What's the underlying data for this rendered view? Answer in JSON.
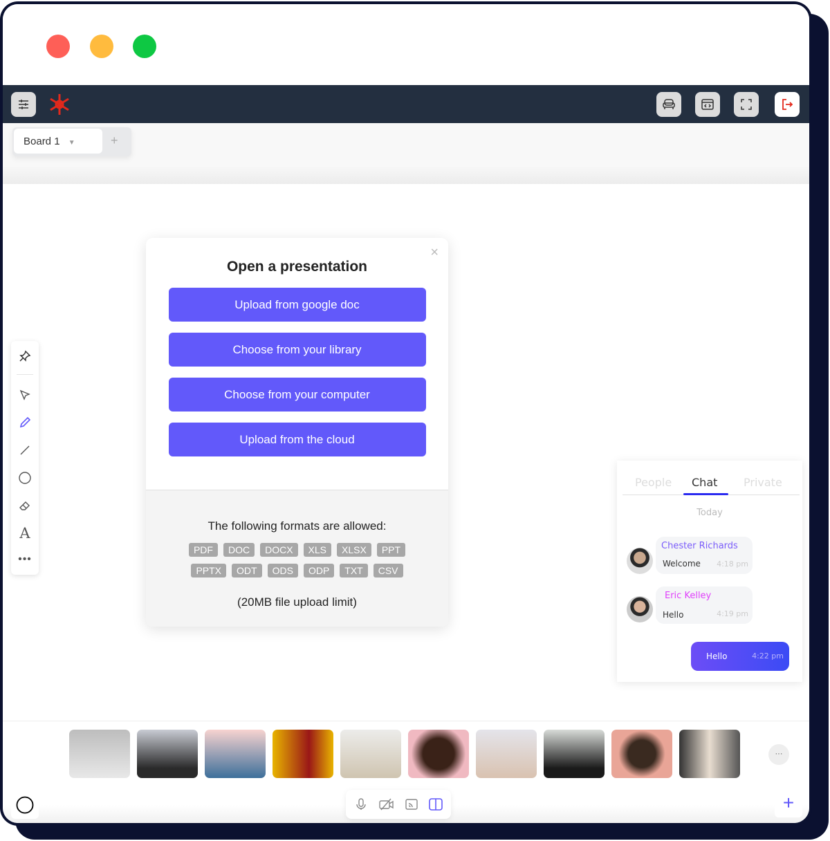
{
  "window": {
    "controls": [
      {
        "name": "close",
        "color": "#fe5f57"
      },
      {
        "name": "minimize",
        "color": "#ffbb3e"
      },
      {
        "name": "maximize",
        "color": "#0ec843"
      }
    ]
  },
  "topbar": {
    "icons": [
      "settings-sliders-icon",
      "logo-icon",
      "sofa-icon",
      "embed-code-icon",
      "fullscreen-icon",
      "exit-icon"
    ],
    "brand_color": "#e3291c"
  },
  "board": {
    "tab_label": "Board 1",
    "add_label": "+"
  },
  "modal": {
    "title": "Open a presentation",
    "close": "×",
    "buttons": [
      "Upload from google doc",
      "Choose from your library",
      "Choose from your computer",
      "Upload from the cloud"
    ],
    "formats_label": "The following formats are allowed:",
    "formats_row1": [
      "PDF",
      "DOC",
      "DOCX",
      "XLS",
      "XLSX",
      "PPT"
    ],
    "formats_row2": [
      "PPTX",
      "ODT",
      "ODS",
      "ODP",
      "TXT",
      "CSV"
    ],
    "limit": "(20MB file upload limit)",
    "accent": "#6259fa"
  },
  "tools": [
    "pin-icon",
    "pointer-icon",
    "pencil-icon",
    "line-icon",
    "circle-icon",
    "eraser-icon",
    "text-icon",
    "more-icon"
  ],
  "chat": {
    "tabs": [
      "People",
      "Chat",
      "Private"
    ],
    "active_tab": "Chat",
    "date": "Today",
    "messages": [
      {
        "name": "Chester Richards",
        "text": "Welcome",
        "time": "4:18 pm",
        "name_color": "#7a5cfa"
      },
      {
        "name": "Eric Kelley",
        "text": "Hello",
        "time": "4:19 pm",
        "name_color": "#e040fb"
      }
    ],
    "own": {
      "text": "Hello",
      "time": "4:22 pm"
    }
  },
  "participants": {
    "count": 10,
    "more": "···"
  },
  "bottom": {
    "icons": [
      "microphone-icon",
      "camera-off-icon",
      "cast-icon",
      "layout-icon"
    ],
    "add": "+"
  }
}
